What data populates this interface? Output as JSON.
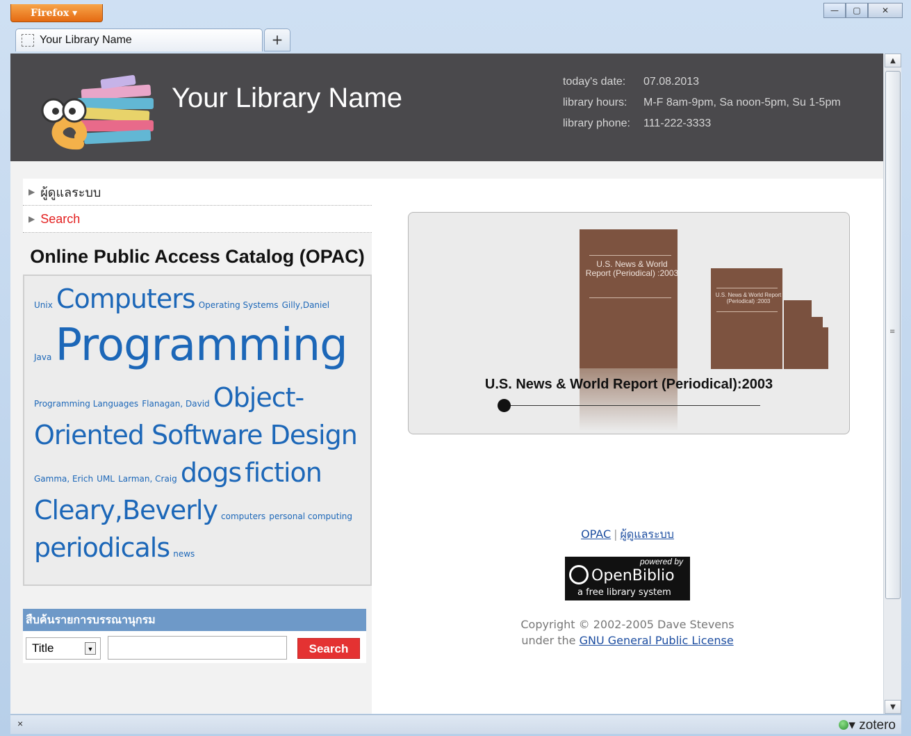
{
  "browser": {
    "menu_button": "Firefox",
    "tab_title": "Your Library Name",
    "new_tab_label": "+",
    "status_left": "×",
    "status_right": "zotero"
  },
  "header": {
    "site_title": "Your Library Name",
    "date_label": "today's date:",
    "date_value": "07.08.2013",
    "hours_label": "library hours:",
    "hours_value": "M-F 8am-9pm, Sa noon-5pm, Su 1-5pm",
    "phone_label": "library phone:",
    "phone_value": "111-222-3333"
  },
  "nav": {
    "items": [
      {
        "label": "ผู้ดูแลระบบ"
      },
      {
        "label": "Search"
      }
    ]
  },
  "opac": {
    "title": "Online Public Access Catalog (OPAC)"
  },
  "tagcloud": {
    "tags": [
      "Unix",
      "Computers",
      "Operating Systems",
      "Gilly,Daniel",
      "Java",
      "Programming",
      "Programming Languages",
      "Flanagan, David",
      "Object-Oriented Software Design",
      "Gamma, Erich",
      "UML",
      "Larman, Craig",
      "dogs",
      "fiction",
      "Cleary,Beverly",
      "computers",
      "personal computing",
      "periodicals",
      "news"
    ]
  },
  "search": {
    "heading": "สืบค้นรายการบรรณานุกรม",
    "field_selected": "Title",
    "button": "Search"
  },
  "carousel": {
    "caption": "U.S. News & World Report (Periodical):2003",
    "book_title": "U.S. News & World Report (Periodical) :2003",
    "book_small_title": "U.S. News & World Report (Periodical) :2003"
  },
  "footer": {
    "link_opac": "OPAC",
    "separator": "|",
    "link_admin": "ผู้ดูแลระบบ",
    "powered_by": "powered by",
    "openbiblio": "OpenBiblio",
    "tagline": "a free library system",
    "copyright": "Copyright © 2002-2005 Dave Stevens",
    "license_prefix": "under the",
    "license_link": "GNU General Public License"
  }
}
